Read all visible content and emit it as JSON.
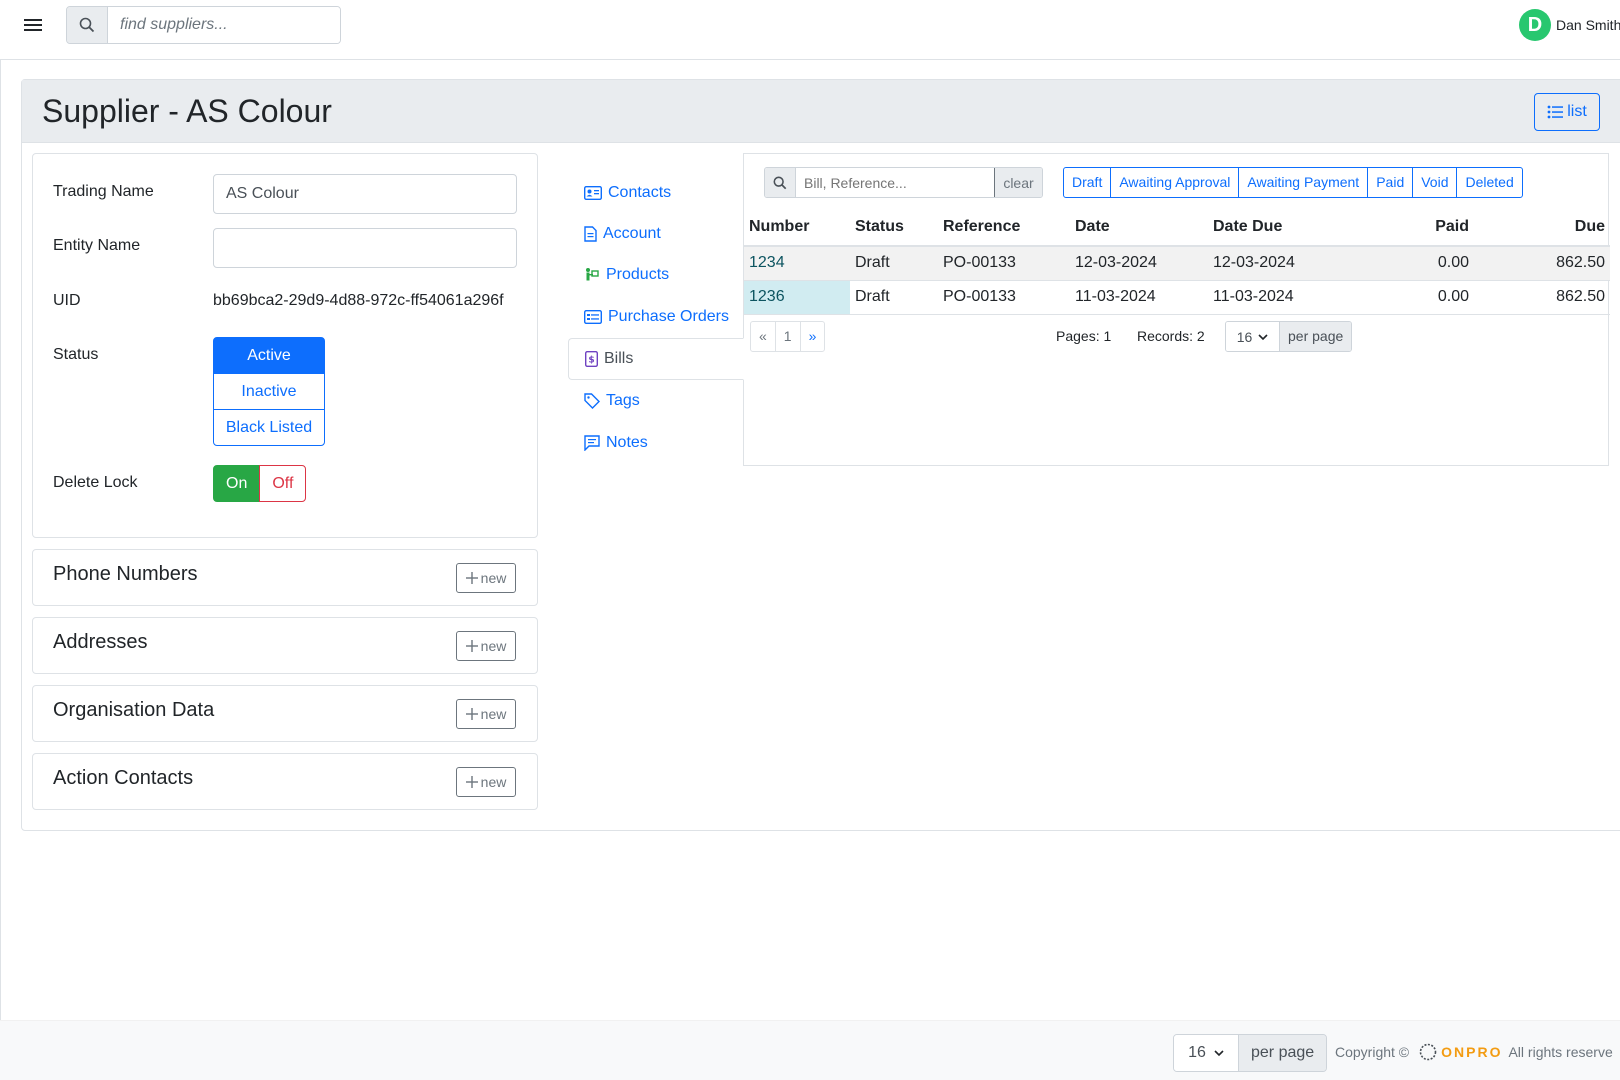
{
  "header": {
    "search_placeholder": "find suppliers...",
    "user_initial": "D",
    "user_name": "Dan Smith"
  },
  "page": {
    "title": "Supplier - AS Colour",
    "list_button": "list"
  },
  "form": {
    "trading_name_label": "Trading Name",
    "trading_name_value": "AS Colour",
    "entity_name_label": "Entity Name",
    "entity_name_value": "",
    "uid_label": "UID",
    "uid_value": "bb69bca2-29d9-4d88-972c-ff54061a296f",
    "status_label": "Status",
    "status_options": [
      "Active",
      "Inactive",
      "Black Listed"
    ],
    "status_selected": "Active",
    "delete_lock_label": "Delete Lock",
    "delete_lock_on": "On",
    "delete_lock_off": "Off",
    "delete_lock_selected": "On"
  },
  "sections": [
    {
      "title": "Phone Numbers",
      "button": "new"
    },
    {
      "title": "Addresses",
      "button": "new"
    },
    {
      "title": "Organisation Data",
      "button": "new"
    },
    {
      "title": "Action Contacts",
      "button": "new"
    }
  ],
  "nav": {
    "items": [
      {
        "label": "Contacts",
        "icon": "contact-card-icon"
      },
      {
        "label": "Account",
        "icon": "document-icon"
      },
      {
        "label": "Products",
        "icon": "person-box-icon"
      },
      {
        "label": "Purchase Orders",
        "icon": "card-list-icon"
      },
      {
        "label": "Bills",
        "icon": "bill-icon"
      },
      {
        "label": "Tags",
        "icon": "tag-icon"
      },
      {
        "label": "Notes",
        "icon": "chat-icon"
      }
    ],
    "active": "Bills"
  },
  "bills": {
    "search_placeholder": "Bill, Reference...",
    "clear_label": "clear",
    "filters": [
      "Draft",
      "Awaiting Approval",
      "Awaiting Payment",
      "Paid",
      "Void",
      "Deleted"
    ],
    "columns": [
      "Number",
      "Status",
      "Reference",
      "Date",
      "Date Due",
      "Paid",
      "Due"
    ],
    "rows": [
      {
        "number": "1234",
        "status": "Draft",
        "reference": "PO-00133",
        "date": "12-03-2024",
        "date_due": "12-03-2024",
        "paid": "0.00",
        "due": "862.50"
      },
      {
        "number": "1236",
        "status": "Draft",
        "reference": "PO-00133",
        "date": "11-03-2024",
        "date_due": "11-03-2024",
        "paid": "0.00",
        "due": "862.50"
      }
    ],
    "pager": {
      "prev": "«",
      "page": "1",
      "next": "»"
    },
    "pages_text": "Pages: 1",
    "records_text": "Records: 2",
    "per_page_value": "16",
    "per_page_label": "per page"
  },
  "footer": {
    "per_page_value": "16",
    "per_page_label": "per page",
    "copyright": "Copyright ©",
    "brand": "ONPRO",
    "rights": "All rights reserve"
  }
}
